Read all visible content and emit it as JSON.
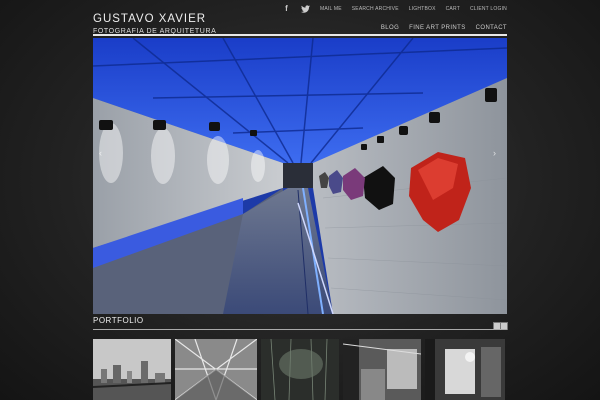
{
  "brand": {
    "name": "GUSTAVO XAVIER",
    "subtitle": "FOTOGRAFIA DE ARQUITETURA"
  },
  "util_nav": [
    "MAIL ME",
    "SEARCH ARCHIVE",
    "LIGHTBOX",
    "CART",
    "CLIENT LOGIN"
  ],
  "main_nav": [
    "BLOG",
    "FINE ART PRINTS",
    "CONTACT"
  ],
  "section": {
    "title": "PORTFOLIO"
  },
  "icons": {
    "facebook": "facebook-icon",
    "twitter": "twitter-icon",
    "prev": "chevron-left-icon",
    "next": "chevron-right-icon"
  },
  "colors": {
    "background": "#2b2b2b",
    "accent_blue": "#2a55e0",
    "text": "#dddddd"
  }
}
